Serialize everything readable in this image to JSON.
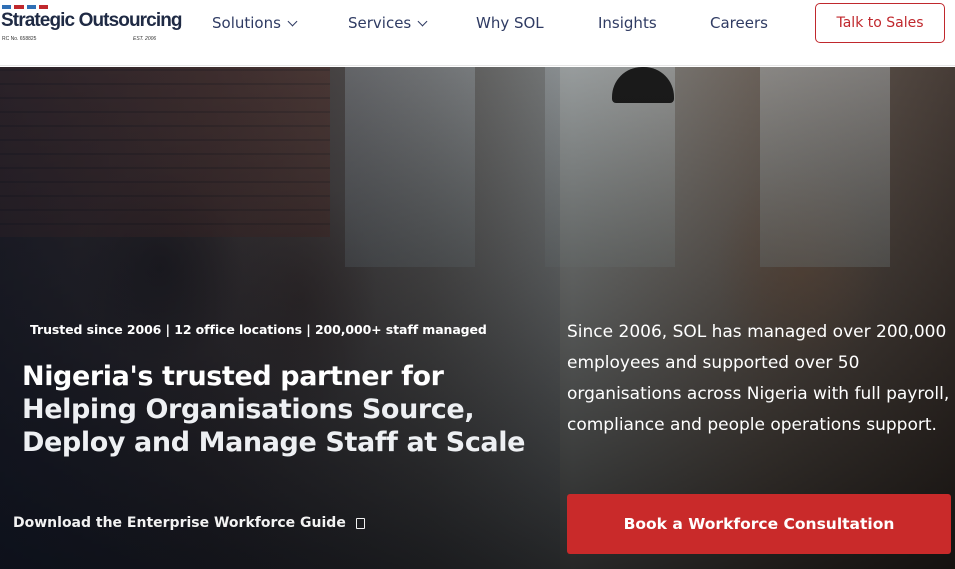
{
  "brand": {
    "name": "Strategic Outsourcing",
    "rc_number": "RC No. 658825",
    "established": "EST. 2006",
    "colors": {
      "navy": "#1f2a44",
      "red": "#c0282d",
      "blue": "#2f6fb5"
    }
  },
  "nav": {
    "items": [
      {
        "label": "Solutions",
        "dropdown": true
      },
      {
        "label": "Services",
        "dropdown": true
      },
      {
        "label": "Why SOL",
        "dropdown": false
      },
      {
        "label": "Insights",
        "dropdown": false
      },
      {
        "label": "Careers",
        "dropdown": false
      }
    ],
    "cta_label": "Talk to Sales"
  },
  "hero": {
    "stats": "Trusted since 2006 | 12 office locations | 200,000+ staff managed",
    "headline_primary": "Nigeria's trusted partner for",
    "headline_secondary": "Helping Organisations Source, Deploy and Manage Staff at Scale",
    "download_label": "Download the Enterprise Workforce Guide",
    "download_icon": "document-icon",
    "description": "Since 2006, SOL has managed over 200,000 employees and supported over 50 organisations across Nigeria with full payroll, compliance and people operations support.",
    "cta_label": "Book a Workforce Consultation",
    "cta_color": "#c92a2a"
  }
}
